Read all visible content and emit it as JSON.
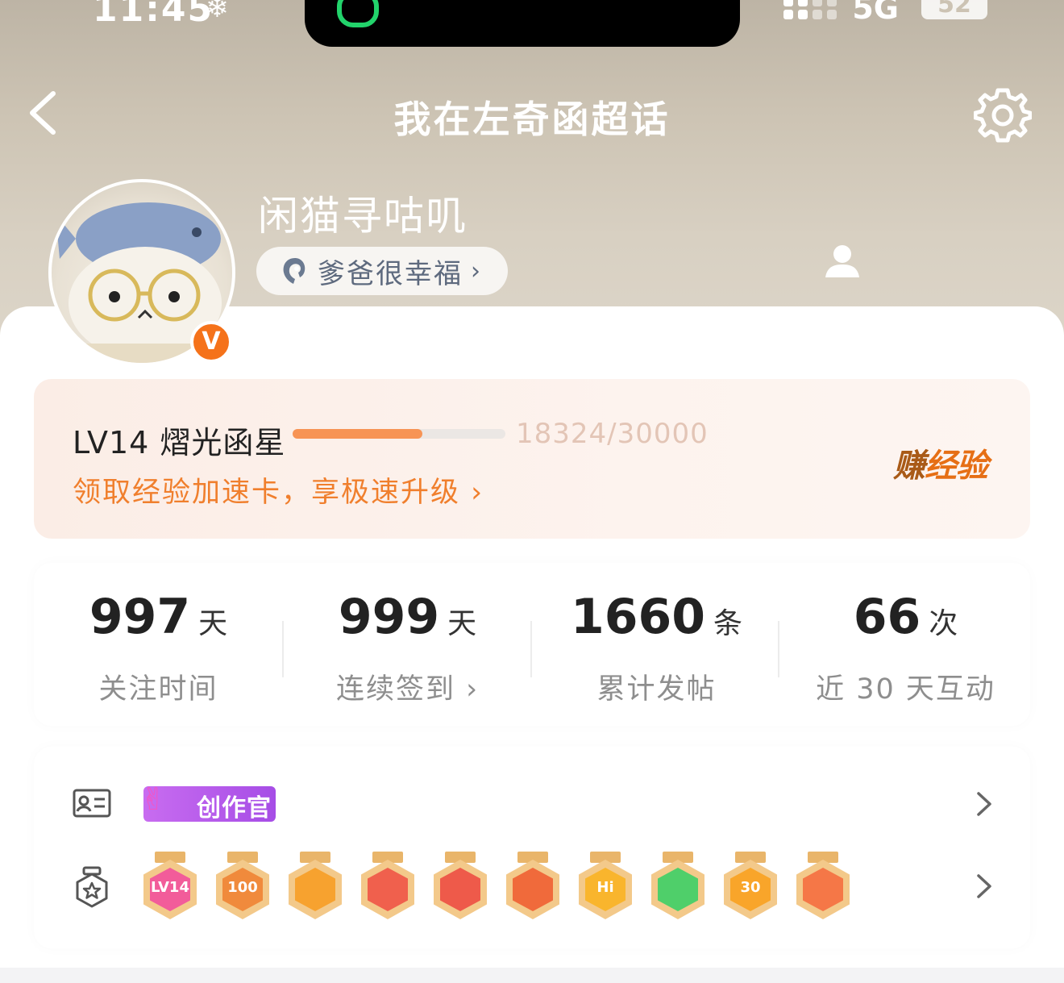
{
  "status_bar": {
    "time": "11:45",
    "network": "5G",
    "battery": "52"
  },
  "nav": {
    "title": "我在左奇函超话"
  },
  "profile": {
    "username": "闲猫寻咕叽",
    "verified_badge": "V",
    "title_pill": "爹爸很幸福"
  },
  "level": {
    "label": "LV14 熠光函星",
    "exp_text": "18324/30000",
    "progress": 0.611,
    "speedup_text": "领取经验加速卡，享极速升级",
    "earn_button_a": "赚",
    "earn_button_b": "经验"
  },
  "stats": [
    {
      "value": "997",
      "unit": "天",
      "label": "关注时间"
    },
    {
      "value": "999",
      "unit": "天",
      "label": "连续签到 ›"
    },
    {
      "value": "1660",
      "unit": "条",
      "label": "累计发帖"
    },
    {
      "value": "66",
      "unit": "次",
      "label": "近 30 天互动"
    }
  ],
  "identity_row": {
    "icon": "id-card-icon",
    "tag": "创作官"
  },
  "medals_row": {
    "icon": "medal-icon",
    "medals": [
      {
        "name": "lv14-medal",
        "text": "LV14",
        "color": "#f25c9a"
      },
      {
        "name": "100-days-medal",
        "text": "100",
        "color": "#f08a3c"
      },
      {
        "name": "crown-medal",
        "text": "",
        "color": "#f7a22f"
      },
      {
        "name": "dragon-medal-1",
        "text": "",
        "color": "#f0604d"
      },
      {
        "name": "dragon-medal-2",
        "text": "",
        "color": "#ee5a4a"
      },
      {
        "name": "dragon-medal-3",
        "text": "",
        "color": "#f06a3b"
      },
      {
        "name": "hi-medal",
        "text": "Hi",
        "color": "#f9b52d"
      },
      {
        "name": "hand-medal",
        "text": "",
        "color": "#4fcf6a"
      },
      {
        "name": "30-days-medal",
        "text": "30",
        "color": "#f9a52a"
      },
      {
        "name": "rock-hand-medal",
        "text": "",
        "color": "#f57747"
      }
    ]
  }
}
